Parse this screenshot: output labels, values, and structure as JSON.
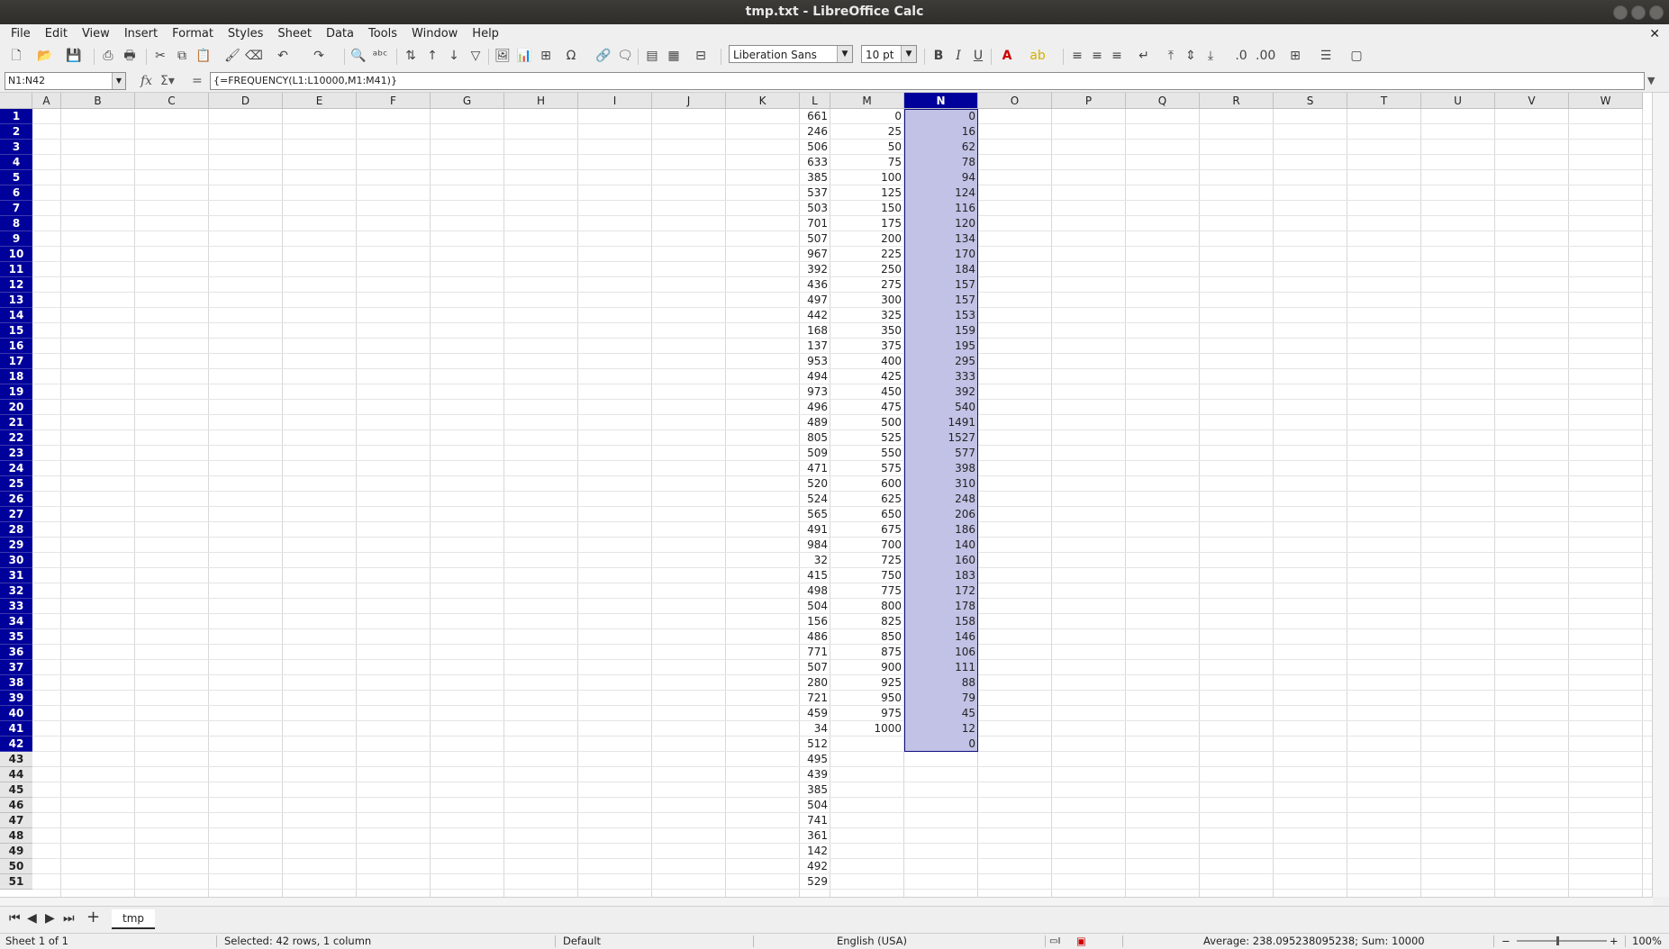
{
  "window": {
    "title": "tmp.txt - LibreOffice Calc"
  },
  "menu": [
    "File",
    "Edit",
    "View",
    "Insert",
    "Format",
    "Styles",
    "Sheet",
    "Data",
    "Tools",
    "Window",
    "Help"
  ],
  "toolbar": {
    "font_name": "Liberation Sans",
    "font_size": "10 pt",
    "bold": "B",
    "italic": "I",
    "underline": "U"
  },
  "formula_bar": {
    "name_box": "N1:N42",
    "formula": "{=FREQUENCY(L1:L10000,M1:M41)}"
  },
  "columns": [
    "A",
    "B",
    "C",
    "D",
    "E",
    "F",
    "G",
    "H",
    "I",
    "J",
    "K",
    "L",
    "M",
    "N",
    "O",
    "P",
    "Q",
    "R",
    "S",
    "T",
    "U",
    "V",
    "W"
  ],
  "selected_column": "N",
  "selected_rows_count": 42,
  "col_L": [
    661,
    246,
    506,
    633,
    385,
    537,
    503,
    701,
    507,
    967,
    392,
    436,
    497,
    442,
    168,
    137,
    953,
    494,
    973,
    496,
    489,
    805,
    509,
    471,
    520,
    524,
    565,
    491,
    984,
    32,
    415,
    498,
    504,
    156,
    486,
    771,
    507,
    280,
    721,
    459,
    34,
    512,
    495,
    439,
    385,
    504,
    741,
    361,
    142,
    492,
    529
  ],
  "col_M": [
    0,
    25,
    50,
    75,
    100,
    125,
    150,
    175,
    200,
    225,
    250,
    275,
    300,
    325,
    350,
    375,
    400,
    425,
    450,
    475,
    500,
    525,
    550,
    575,
    600,
    625,
    650,
    675,
    700,
    725,
    750,
    775,
    800,
    825,
    850,
    875,
    900,
    925,
    950,
    975,
    1000
  ],
  "col_N": [
    0,
    16,
    62,
    78,
    94,
    124,
    116,
    120,
    134,
    170,
    184,
    157,
    157,
    153,
    159,
    195,
    295,
    333,
    392,
    540,
    1491,
    1527,
    577,
    398,
    310,
    248,
    206,
    186,
    140,
    160,
    183,
    172,
    178,
    158,
    146,
    106,
    111,
    88,
    79,
    45,
    12,
    0
  ],
  "sheet_tab": "tmp",
  "status": {
    "sheet": "Sheet 1 of 1",
    "selection": "Selected: 42 rows, 1 column",
    "page_style": "Default",
    "language": "English (USA)",
    "summary": "Average: 238.095238095238; Sum: 10000",
    "zoom": "100%"
  }
}
